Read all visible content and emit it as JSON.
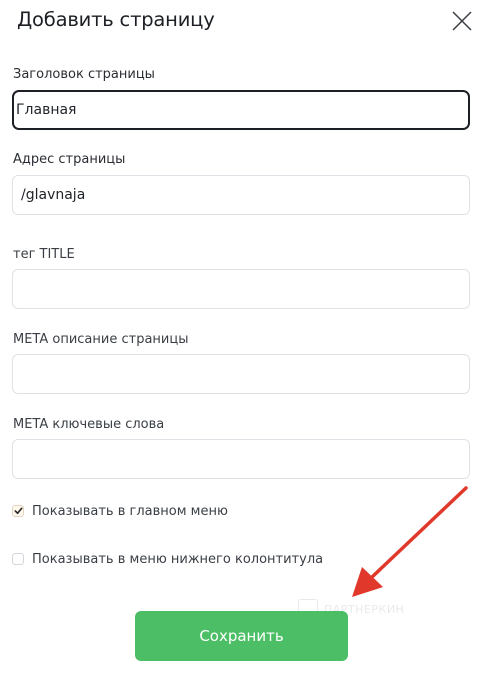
{
  "dialog": {
    "title": "Добавить страницу",
    "close_icon": "close-icon"
  },
  "fields": {
    "page_title": {
      "label": "Заголовок страницы",
      "value": "Главная"
    },
    "page_url": {
      "label": "Адрес страницы",
      "value": "/glavnaja"
    },
    "title_tag": {
      "label": "тег TITLE",
      "value": ""
    },
    "meta_description": {
      "label": "META описание страницы",
      "value": ""
    },
    "meta_keywords": {
      "label": "META ключевые слова",
      "value": ""
    }
  },
  "checkboxes": {
    "show_in_main_menu": {
      "label": "Показывать в главном меню",
      "checked": true
    },
    "show_in_footer_menu": {
      "label": "Показывать в меню нижнего колонтитула",
      "checked": false
    }
  },
  "actions": {
    "save_label": "Сохранить"
  },
  "colors": {
    "save_button": "#4cbf66",
    "annotation_arrow": "#e0392b",
    "focused_border": "#1c1f24",
    "input_border": "#dfe2e6"
  }
}
